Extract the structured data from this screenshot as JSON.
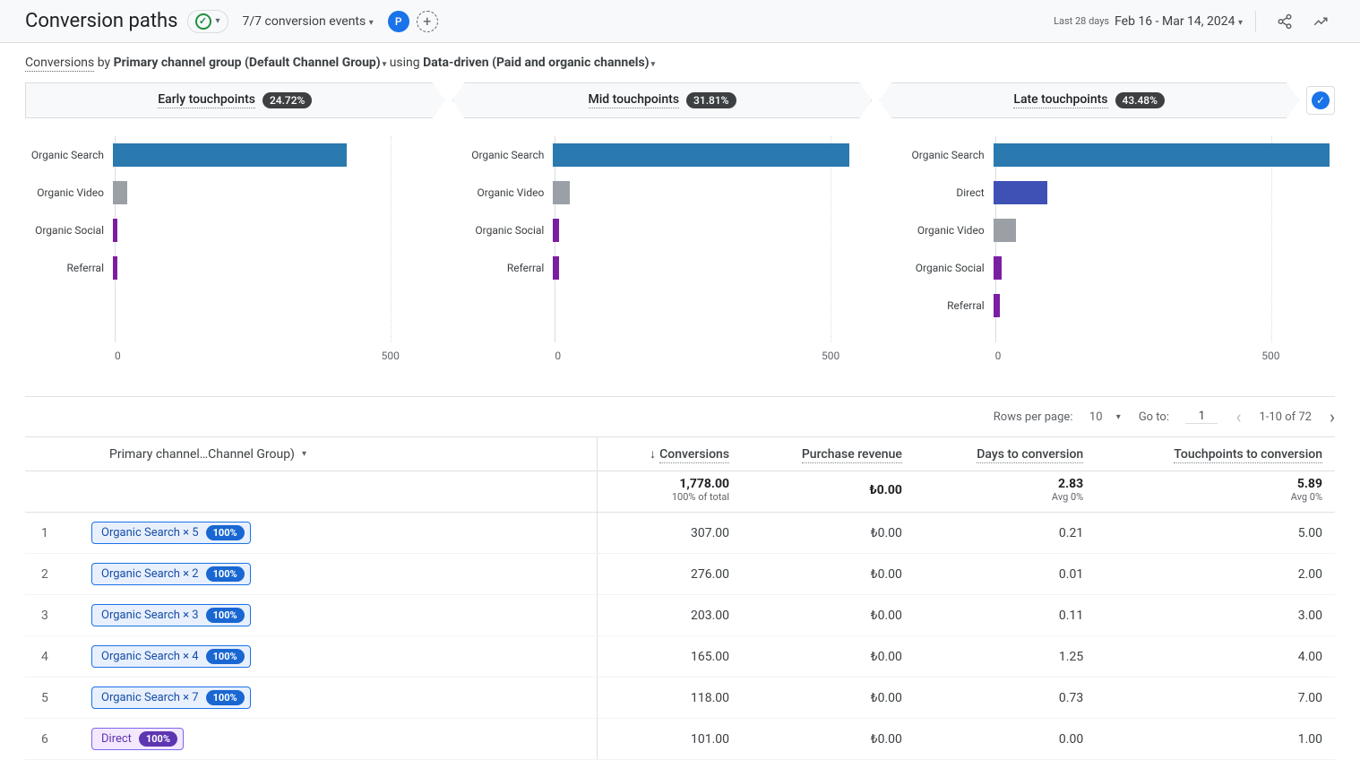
{
  "header": {
    "title": "Conversion paths",
    "events": "7/7 conversion events",
    "avatar": "P",
    "date_label": "Last 28 days",
    "date_range": "Feb 16 - Mar 14, 2024"
  },
  "dimension": {
    "d1": "Conversions",
    "d2": " by ",
    "d3": "Primary channel group (Default Channel Group)",
    "d4": " using ",
    "d5": "Data-driven (Paid and organic channels)"
  },
  "tabs": [
    {
      "label": "Early touchpoints",
      "pill": "24.72%"
    },
    {
      "label": "Mid touchpoints",
      "pill": "31.81%"
    },
    {
      "label": "Late touchpoints",
      "pill": "43.48%"
    }
  ],
  "controls": {
    "rows_label": "Rows per page:",
    "rows_value": "10",
    "goto_label": "Go to:",
    "goto_value": "1",
    "range": "1-10 of 72"
  },
  "columns": {
    "dim": "Primary channel…Channel Group)",
    "c1": "Conversions",
    "c2": "Purchase revenue",
    "c3": "Days to conversion",
    "c4": "Touchpoints to conversion"
  },
  "summary": {
    "c1": "1,778.00",
    "c1s": "100% of total",
    "c2": "₺0.00",
    "c3": "2.83",
    "c3s": "Avg 0%",
    "c4": "5.89",
    "c4s": "Avg 0%"
  },
  "rows": [
    {
      "n": "1",
      "kind": "os",
      "path": "Organic Search × 5",
      "pct": "100%",
      "c1": "307.00",
      "c2": "₺0.00",
      "c3": "0.21",
      "c4": "5.00"
    },
    {
      "n": "2",
      "kind": "os",
      "path": "Organic Search × 2",
      "pct": "100%",
      "c1": "276.00",
      "c2": "₺0.00",
      "c3": "0.01",
      "c4": "2.00"
    },
    {
      "n": "3",
      "kind": "os",
      "path": "Organic Search × 3",
      "pct": "100%",
      "c1": "203.00",
      "c2": "₺0.00",
      "c3": "0.11",
      "c4": "3.00"
    },
    {
      "n": "4",
      "kind": "os",
      "path": "Organic Search × 4",
      "pct": "100%",
      "c1": "165.00",
      "c2": "₺0.00",
      "c3": "1.25",
      "c4": "4.00"
    },
    {
      "n": "5",
      "kind": "os",
      "path": "Organic Search × 7",
      "pct": "100%",
      "c1": "118.00",
      "c2": "₺0.00",
      "c3": "0.73",
      "c4": "7.00"
    },
    {
      "n": "6",
      "kind": "direct",
      "path": "Direct",
      "pct": "100%",
      "c1": "101.00",
      "c2": "₺0.00",
      "c3": "0.00",
      "c4": "1.00"
    }
  ],
  "chart_data": [
    {
      "type": "bar",
      "title": "Early touchpoints",
      "xlabel": "",
      "ylabel": "",
      "xlim": [
        0,
        600
      ],
      "ticks": [
        0,
        500
      ],
      "categories": [
        "Organic Search",
        "Organic Video",
        "Organic Social",
        "Referral"
      ],
      "series": [
        {
          "name": "value",
          "values": [
            410,
            25,
            8,
            8
          ],
          "colors": [
            "#2a7ab0",
            "#9aa0a6",
            "#7b1fa2",
            "#7b1fa2"
          ]
        }
      ]
    },
    {
      "type": "bar",
      "title": "Mid touchpoints",
      "xlabel": "",
      "ylabel": "",
      "xlim": [
        0,
        600
      ],
      "ticks": [
        0,
        500
      ],
      "categories": [
        "Organic Search",
        "Organic Video",
        "Organic Social",
        "Referral"
      ],
      "series": [
        {
          "name": "value",
          "values": [
            520,
            30,
            10,
            10
          ],
          "colors": [
            "#2a7ab0",
            "#9aa0a6",
            "#7b1fa2",
            "#7b1fa2"
          ]
        }
      ]
    },
    {
      "type": "bar",
      "title": "Late touchpoints",
      "xlabel": "",
      "ylabel": "",
      "xlim": [
        0,
        600
      ],
      "ticks": [
        0,
        500
      ],
      "categories": [
        "Organic Search",
        "Direct",
        "Organic Video",
        "Organic Social",
        "Referral"
      ],
      "series": [
        {
          "name": "value",
          "values": [
            590,
            95,
            40,
            15,
            12
          ],
          "colors": [
            "#2a7ab0",
            "#3f51b5",
            "#9aa0a6",
            "#7b1fa2",
            "#7b1fa2"
          ]
        }
      ]
    }
  ]
}
